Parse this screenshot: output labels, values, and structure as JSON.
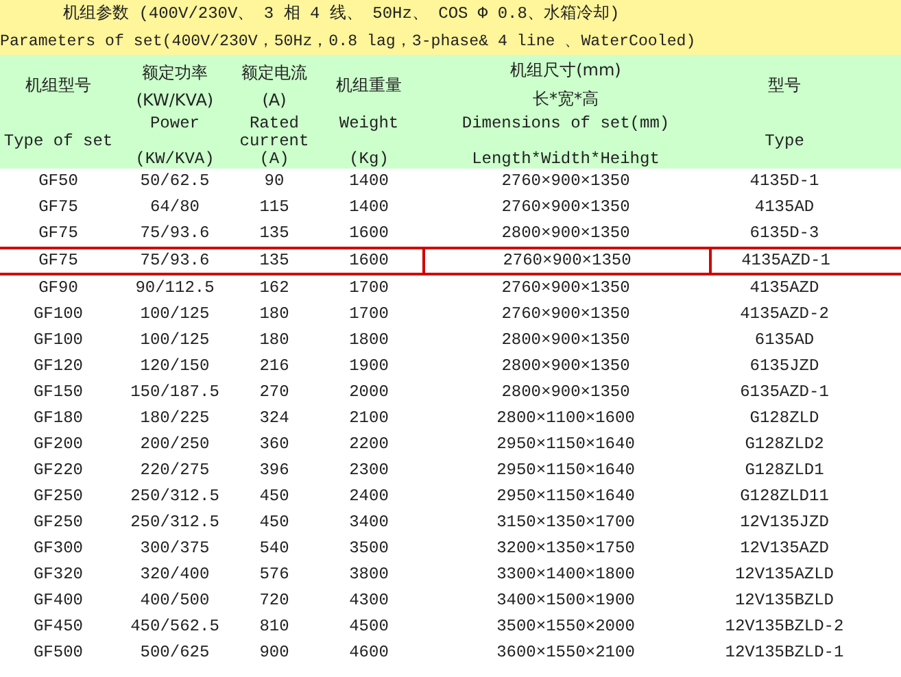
{
  "title_zh": "机组参数 (400V/230V、 3 相 4 线、 50Hz、 COS Φ 0.8、水箱冷却)",
  "title_en": "Parameters of set(400V/230V，50Hz，0.8 lag，3-phase& 4 line 、WaterCooled)",
  "columns": [
    {
      "zh": [
        "机组型号"
      ],
      "en": [
        "Type of set"
      ]
    },
    {
      "zh": [
        "额定功率",
        "(KW/KVA)"
      ],
      "en": [
        "Power",
        "(KW/KVA)"
      ]
    },
    {
      "zh": [
        "额定电流",
        "(A)"
      ],
      "en": [
        "Rated",
        "current",
        "(A)"
      ]
    },
    {
      "zh": [
        "机组重量"
      ],
      "en": [
        "Weight",
        "(Kg)"
      ]
    },
    {
      "zh": [
        "机组尺寸(mm)",
        "长*宽*高"
      ],
      "en": [
        "Dimensions of set(mm)",
        "Length*Width*Heihgt"
      ]
    },
    {
      "zh": [
        "型号"
      ],
      "en": [
        "Type"
      ]
    }
  ],
  "rows": [
    {
      "cells": [
        "GF50",
        "50/62.5",
        "90",
        "1400",
        "2760×900×1350",
        "4135D-1"
      ],
      "selected": false
    },
    {
      "cells": [
        "GF75",
        "64/80",
        "115",
        "1400",
        "2760×900×1350",
        "4135AD"
      ],
      "selected": false
    },
    {
      "cells": [
        "GF75",
        "75/93.6",
        "135",
        "1600",
        "2800×900×1350",
        "6135D-3"
      ],
      "selected": false
    },
    {
      "cells": [
        "GF75",
        "75/93.6",
        "135",
        "1600",
        "2760×900×1350",
        "4135AZD-1"
      ],
      "selected": true
    },
    {
      "cells": [
        "GF90",
        "90/112.5",
        "162",
        "1700",
        "2760×900×1350",
        "4135AZD"
      ],
      "selected": false
    },
    {
      "cells": [
        "GF100",
        "100/125",
        "180",
        "1700",
        "2760×900×1350",
        "4135AZD-2"
      ],
      "selected": false
    },
    {
      "cells": [
        "GF100",
        "100/125",
        "180",
        "1800",
        "2800×900×1350",
        "6135AD"
      ],
      "selected": false
    },
    {
      "cells": [
        "GF120",
        "120/150",
        "216",
        "1900",
        "2800×900×1350",
        "6135JZD"
      ],
      "selected": false
    },
    {
      "cells": [
        "GF150",
        "150/187.5",
        "270",
        "2000",
        "2800×900×1350",
        "6135AZD-1"
      ],
      "selected": false
    },
    {
      "cells": [
        "GF180",
        "180/225",
        "324",
        "2100",
        "2800×1100×1600",
        "G128ZLD"
      ],
      "selected": false
    },
    {
      "cells": [
        "GF200",
        "200/250",
        "360",
        "2200",
        "2950×1150×1640",
        "G128ZLD2"
      ],
      "selected": false
    },
    {
      "cells": [
        "GF220",
        "220/275",
        "396",
        "2300",
        "2950×1150×1640",
        "G128ZLD1"
      ],
      "selected": false
    },
    {
      "cells": [
        "GF250",
        "250/312.5",
        "450",
        "2400",
        "2950×1150×1640",
        "G128ZLD11"
      ],
      "selected": false
    },
    {
      "cells": [
        "GF250",
        "250/312.5",
        "450",
        "3400",
        "3150×1350×1700",
        "12V135JZD"
      ],
      "selected": false
    },
    {
      "cells": [
        "GF300",
        "300/375",
        "540",
        "3500",
        "3200×1350×1750",
        "12V135AZD"
      ],
      "selected": false
    },
    {
      "cells": [
        "GF320",
        "320/400",
        "576",
        "3800",
        "3300×1400×1800",
        "12V135AZLD"
      ],
      "selected": false
    },
    {
      "cells": [
        "GF400",
        "400/500",
        "720",
        "4300",
        "3400×1500×1900",
        "12V135BZLD"
      ],
      "selected": false
    },
    {
      "cells": [
        "GF450",
        "450/562.5",
        "810",
        "4500",
        "3500×1550×2000",
        "12V135BZLD-2"
      ],
      "selected": false
    },
    {
      "cells": [
        "GF500",
        "500/625",
        "900",
        "4600",
        "3600×1550×2100",
        "12V135BZLD-1"
      ],
      "selected": false
    }
  ]
}
